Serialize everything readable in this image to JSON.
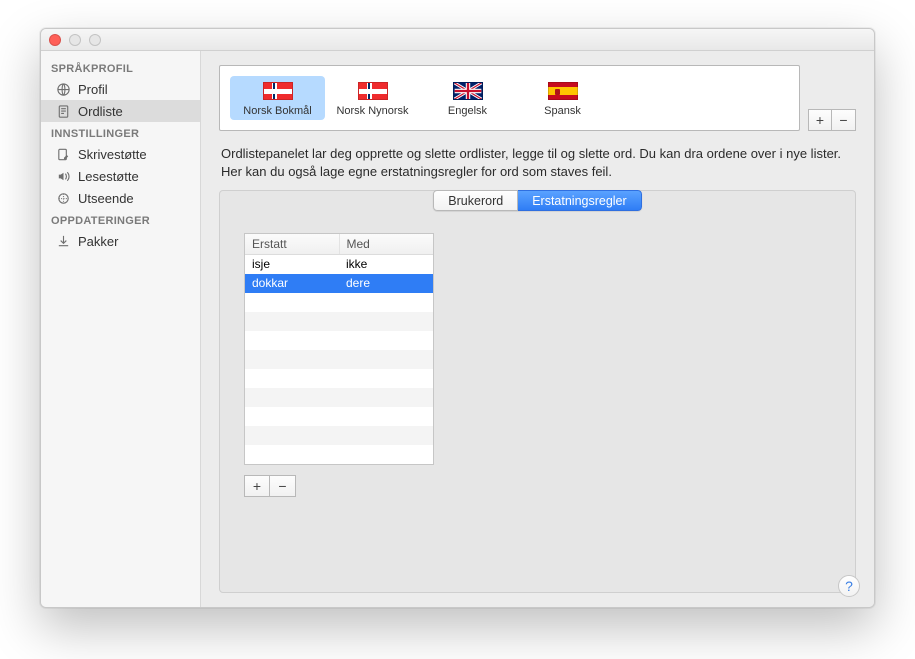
{
  "sidebar": {
    "sections": [
      {
        "header": "SPRÅKPROFIL",
        "items": [
          {
            "label": "Profil",
            "icon": "globe-icon",
            "selected": false
          },
          {
            "label": "Ordliste",
            "icon": "page-icon",
            "selected": true
          }
        ]
      },
      {
        "header": "INNSTILLINGER",
        "items": [
          {
            "label": "Skrivestøtte",
            "icon": "pencil-icon",
            "selected": false
          },
          {
            "label": "Lesestøtte",
            "icon": "speaker-icon",
            "selected": false
          },
          {
            "label": "Utseende",
            "icon": "appearance-icon",
            "selected": false
          }
        ]
      },
      {
        "header": "OPPDATERINGER",
        "items": [
          {
            "label": "Pakker",
            "icon": "download-icon",
            "selected": false
          }
        ]
      }
    ]
  },
  "languages": [
    {
      "label": "Norsk Bokmål",
      "flag": "nor",
      "selected": true
    },
    {
      "label": "Norsk Nynorsk",
      "flag": "nor",
      "selected": false
    },
    {
      "label": "Engelsk",
      "flag": "uk",
      "selected": false
    },
    {
      "label": "Spansk",
      "flag": "es",
      "selected": false
    }
  ],
  "description": "Ordlistepanelet lar deg opprette og slette ordlister, legge til og slette ord. Du kan dra ordene over i nye lister. Her kan du også lage egne erstatningsregler for ord som staves feil.",
  "tabs": {
    "user_words": "Brukerord",
    "replacement_rules": "Erstatningsregler",
    "active": "replacement_rules"
  },
  "table": {
    "columns": {
      "replace": "Erstatt",
      "with": "Med"
    },
    "rows": [
      {
        "replace": "isje",
        "with": "ikke",
        "selected": false
      },
      {
        "replace": "dokkar",
        "with": "dere",
        "selected": true
      }
    ],
    "blank_rows": 9
  },
  "buttons": {
    "plus": "+",
    "minus": "−",
    "help": "?"
  }
}
